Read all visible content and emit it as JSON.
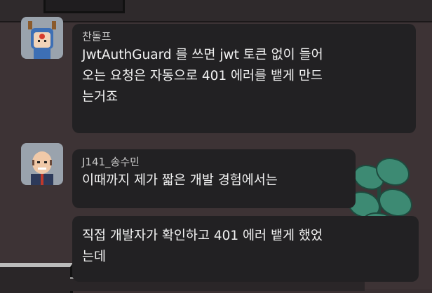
{
  "messages": [
    {
      "sender": "찬돌프",
      "text": "JwtAuthGuard 를 쓰면 jwt 토큰 없이 들어\n오는 요청은 자동으로 401 에러를 뱉게 만드\n는거죠",
      "avatar_icon": "reindeer-avatar-icon"
    },
    {
      "sender": "J141_송수민",
      "text": "이때까지 제가 짧은 개발 경험에서는",
      "avatar_icon": "bald-man-avatar-icon"
    },
    {
      "text": "직접 개발자가 확인하고 401 에러 뱉게 했었\n는데"
    }
  ],
  "colors": {
    "bubble": "#222123",
    "text": "#f2f2f2",
    "sender": "#c9c9c9",
    "background": "#3d3335"
  }
}
